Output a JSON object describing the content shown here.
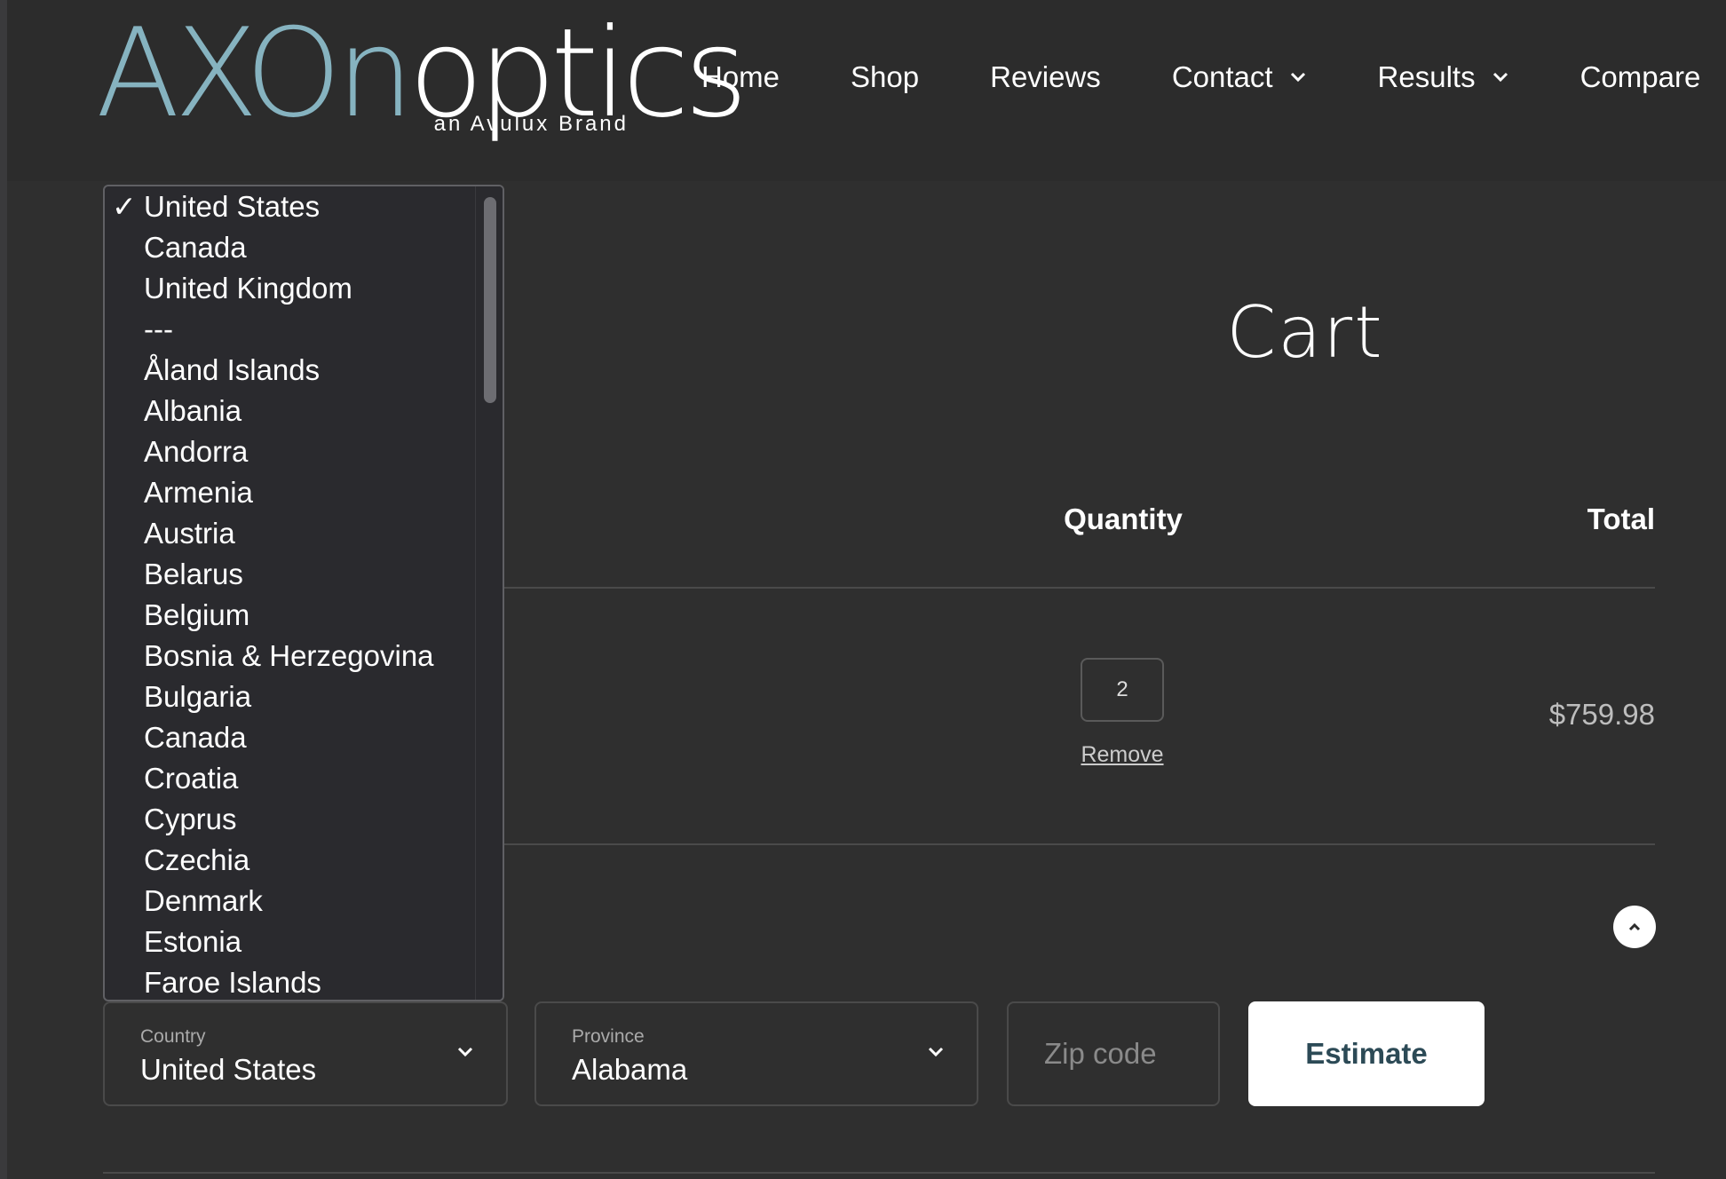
{
  "logo": {
    "brand_part1": "AXOn",
    "brand_part2": "optics",
    "tagline": "an Avulux Brand"
  },
  "nav": {
    "items": [
      {
        "label": "Home",
        "dropdown": false
      },
      {
        "label": "Shop",
        "dropdown": false
      },
      {
        "label": "Reviews",
        "dropdown": false
      },
      {
        "label": "Contact",
        "dropdown": true
      },
      {
        "label": "Results",
        "dropdown": true
      },
      {
        "label": "Compare",
        "dropdown": false
      }
    ]
  },
  "page": {
    "title": "Cart"
  },
  "table": {
    "quantity_header": "Quantity",
    "total_header": "Total"
  },
  "line_item": {
    "quantity": "2",
    "remove_label": "Remove",
    "total": "$759.98"
  },
  "shipping": {
    "country_label": "Country",
    "country_value": "United States",
    "province_label": "Province",
    "province_value": "Alabama",
    "zip_placeholder": "Zip code",
    "estimate_label": "Estimate"
  },
  "country_dropdown": {
    "check_glyph": "✓",
    "options": [
      "United States",
      "Canada",
      "United Kingdom",
      "---",
      "Åland Islands",
      "Albania",
      "Andorra",
      "Armenia",
      "Austria",
      "Belarus",
      "Belgium",
      "Bosnia & Herzegovina",
      "Bulgaria",
      "Canada",
      "Croatia",
      "Cyprus",
      "Czechia",
      "Denmark",
      "Estonia",
      "Faroe Islands"
    ],
    "selected_index": 0
  },
  "colors": {
    "background": "#2f2f2f",
    "header": "#2c2c2c",
    "logo_accent": "#86b3c0",
    "estimate_text": "#2c4a56"
  }
}
